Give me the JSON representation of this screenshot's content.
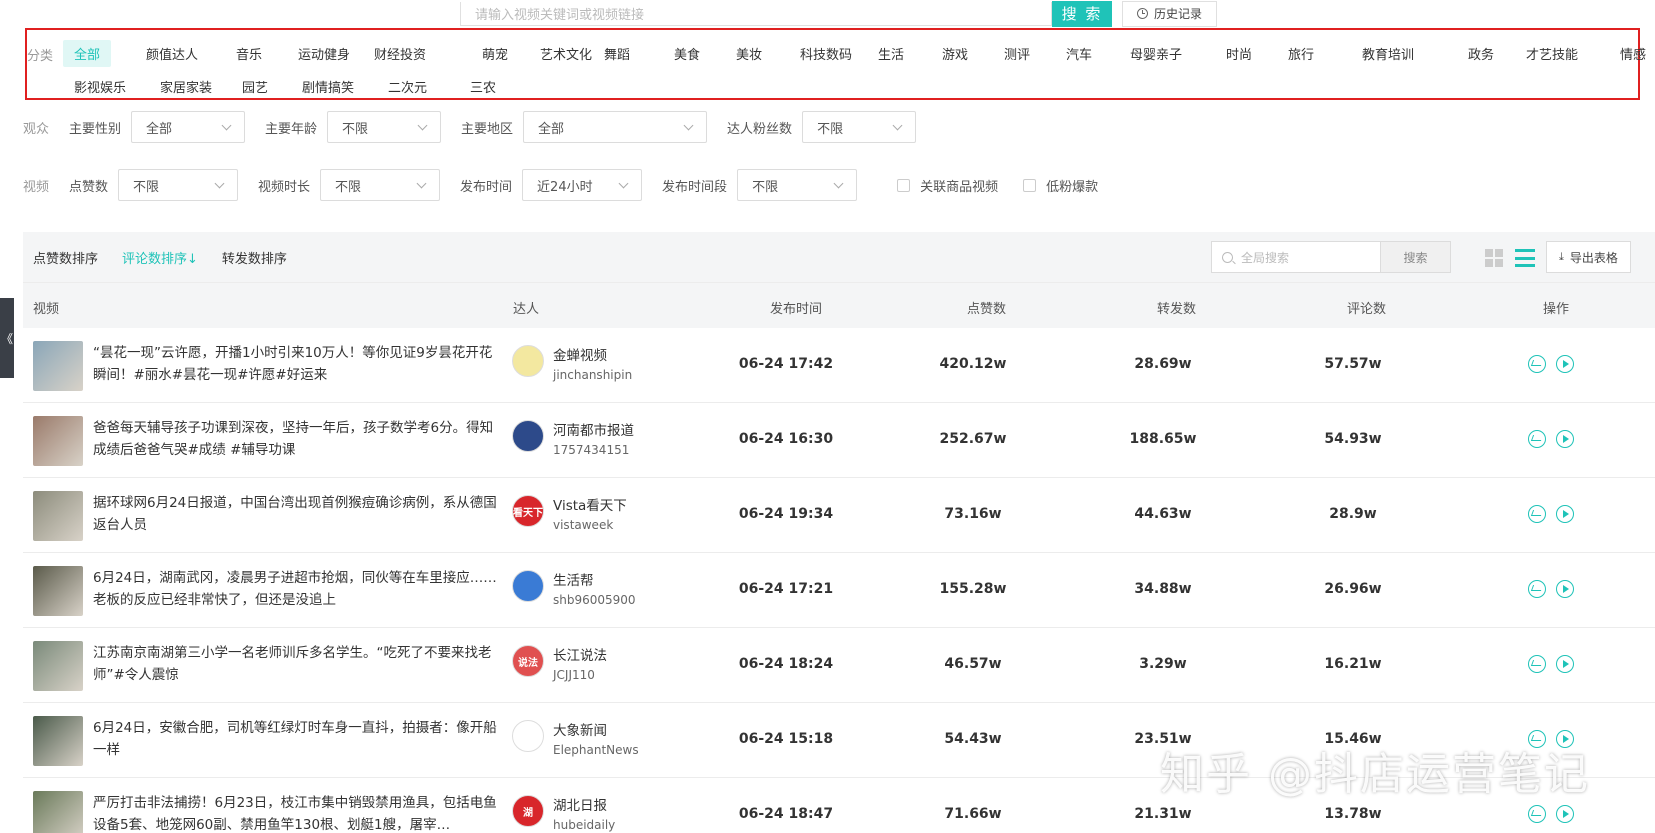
{
  "search": {
    "placeholder": "请输入视频关键词或视频链接",
    "button": "搜 索",
    "history": "历史记录"
  },
  "category": {
    "label": "分类",
    "row1": [
      "全部",
      "颜值达人",
      "音乐",
      "运动健身",
      "财经投资",
      "萌宠",
      "艺术文化",
      "舞蹈",
      "美食",
      "美妆",
      "科技数码",
      "生活",
      "游戏",
      "测评",
      "汽车",
      "母婴亲子",
      "时尚",
      "旅行",
      "教育培训",
      "政务",
      "才艺技能",
      "情感"
    ],
    "row2": [
      "影视娱乐",
      "家居家装",
      "园艺",
      "剧情搞笑",
      "二次元",
      "三农"
    ],
    "active": "全部"
  },
  "audience": {
    "group": "观众",
    "gender_label": "主要性别",
    "gender_value": "全部",
    "age_label": "主要年龄",
    "age_value": "不限",
    "region_label": "主要地区",
    "region_value": "全部",
    "fans_label": "达人粉丝数",
    "fans_value": "不限"
  },
  "video": {
    "group": "视频",
    "likes_label": "点赞数",
    "likes_value": "不限",
    "duration_label": "视频时长",
    "duration_value": "不限",
    "time_label": "发布时间",
    "time_value": "近24小时",
    "period_label": "发布时间段",
    "period_value": "不限",
    "check1": "关联商品视频",
    "check2": "低粉爆款"
  },
  "toolbar": {
    "sort_likes": "点赞数排序",
    "sort_comments": "评论数排序↓",
    "sort_shares": "转发数排序",
    "search_placeholder": "全局搜索",
    "search_button": "搜索",
    "export": "导出表格"
  },
  "table": {
    "headers": {
      "video": "视频",
      "creator": "达人",
      "time": "发布时间",
      "likes": "点赞数",
      "shares": "转发数",
      "comments": "评论数",
      "ops": "操作"
    },
    "rows": [
      {
        "title": "“昙花一现”云许愿，开播1小时引来10万人！等你见证9岁昙花开花瞬间！#丽水#昙花一现#许愿#好运来",
        "name": "金蝉视频",
        "id": "jinchanshipin",
        "time": "06-24 17:42",
        "likes": "420.12w",
        "shares": "28.69w",
        "comments": "57.57w",
        "avatar_text": "",
        "avatar_color": "#f3e8a0",
        "thumb_color": "#8aa6b8"
      },
      {
        "title": "爸爸每天辅导孩子功课到深夜，坚持一年后，孩子数学考6分。得知成绩后爸爸气哭#成绩 #辅导功课",
        "name": "河南都市报道",
        "id": "1757434151",
        "time": "06-24 16:30",
        "likes": "252.67w",
        "shares": "188.65w",
        "comments": "54.93w",
        "avatar_text": "",
        "avatar_color": "#2d4a8a",
        "thumb_color": "#9a7a6a"
      },
      {
        "title": "据环球网6月24日报道，中国台湾出现首例猴痘确诊病例，系从德国返台人员",
        "name": "Vista看天下",
        "id": "vistaweek",
        "time": "06-24 19:34",
        "likes": "73.16w",
        "shares": "44.63w",
        "comments": "28.9w",
        "avatar_text": "看天下",
        "avatar_color": "#d8262b",
        "thumb_color": "#8c8c7c"
      },
      {
        "title": "6月24日，湖南武冈，凌晨男子进超市抢烟，同伙等在车里接应……老板的反应已经非常快了，但还是没追上",
        "name": "生活帮",
        "id": "shb96005900",
        "time": "06-24 17:21",
        "likes": "155.28w",
        "shares": "34.88w",
        "comments": "26.96w",
        "avatar_text": "",
        "avatar_color": "#3a7bd5",
        "thumb_color": "#5a5a4a"
      },
      {
        "title": "江苏南京南湖第三小学一名老师训斥多名学生。“吃死了不要来找老师”#令人震惊",
        "name": "长江说法",
        "id": "JCJJ110",
        "time": "06-24 18:24",
        "likes": "46.57w",
        "shares": "3.29w",
        "comments": "16.21w",
        "avatar_text": "说法",
        "avatar_color": "#e05050",
        "thumb_color": "#7a8a7a"
      },
      {
        "title": "6月24日，安徽合肥，司机等红绿灯时车身一直抖，拍摄者：像开船一样",
        "name": "大象新闻",
        "id": "ElephantNews",
        "time": "06-24 15:18",
        "likes": "54.43w",
        "shares": "23.51w",
        "comments": "15.46w",
        "avatar_text": "",
        "avatar_color": "#ffffff",
        "thumb_color": "#4a5a4a"
      },
      {
        "title": "严厉打击非法捕捞！6月23日，枝江市集中销毁禁用渔具，包括电鱼设备5套、地笼网60副、禁用鱼竿130根、划艇1艘，屠宰…",
        "name": "湖北日报",
        "id": "hubeidaily",
        "time": "06-24 18:47",
        "likes": "71.66w",
        "shares": "21.31w",
        "comments": "13.78w",
        "avatar_text": "湖",
        "avatar_color": "#d8262b",
        "thumb_color": "#6a7a5a"
      }
    ]
  },
  "side_tab": "《",
  "watermark": "知乎 @抖店运营笔记"
}
